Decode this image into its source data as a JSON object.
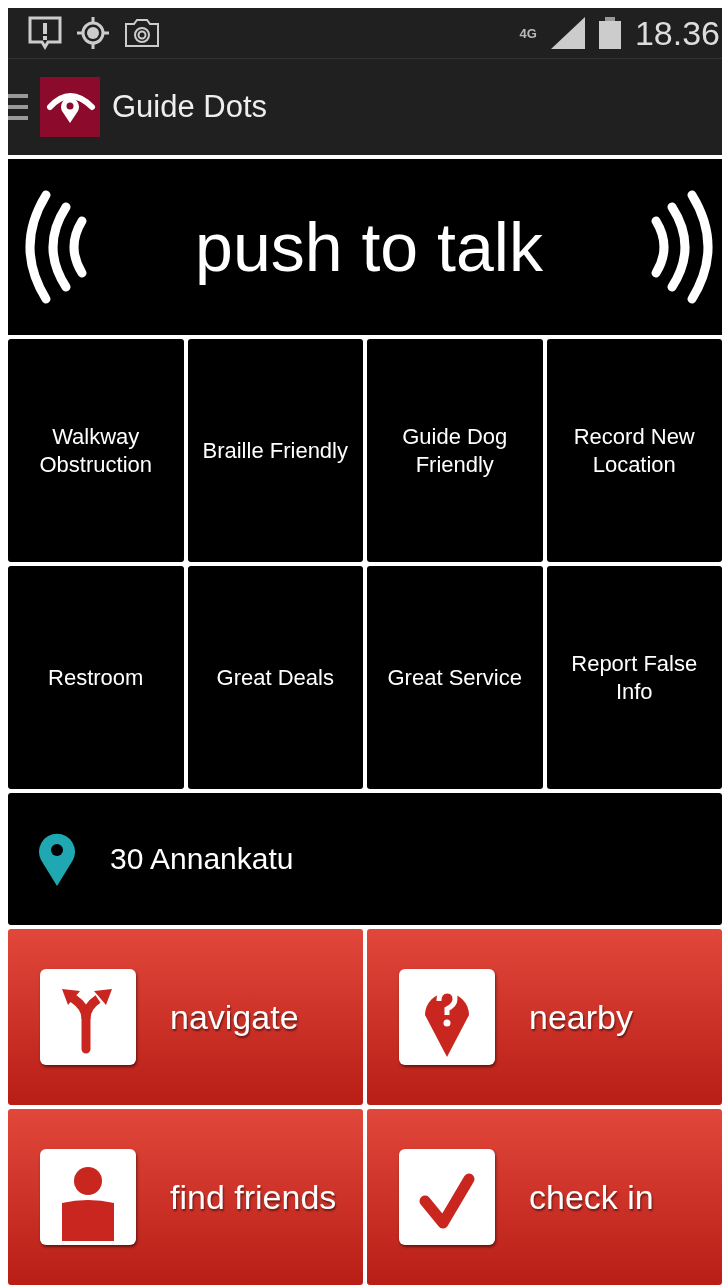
{
  "status_bar": {
    "network": "4G",
    "time": "18.36"
  },
  "app_bar": {
    "title": "Guide Dots"
  },
  "talk_button": {
    "label": "push to talk"
  },
  "categories": [
    {
      "label": "Walkway Obstruction"
    },
    {
      "label": "Braille Friendly"
    },
    {
      "label": "Guide Dog Friendly"
    },
    {
      "label": "Record New Location"
    },
    {
      "label": "Restroom"
    },
    {
      "label": "Great Deals"
    },
    {
      "label": "Great Service"
    },
    {
      "label": "Report False Info"
    }
  ],
  "location": {
    "address": "30 Annankatu"
  },
  "actions": [
    {
      "label": "navigate"
    },
    {
      "label": "nearby"
    },
    {
      "label": "find friends"
    },
    {
      "label": "check in"
    }
  ]
}
